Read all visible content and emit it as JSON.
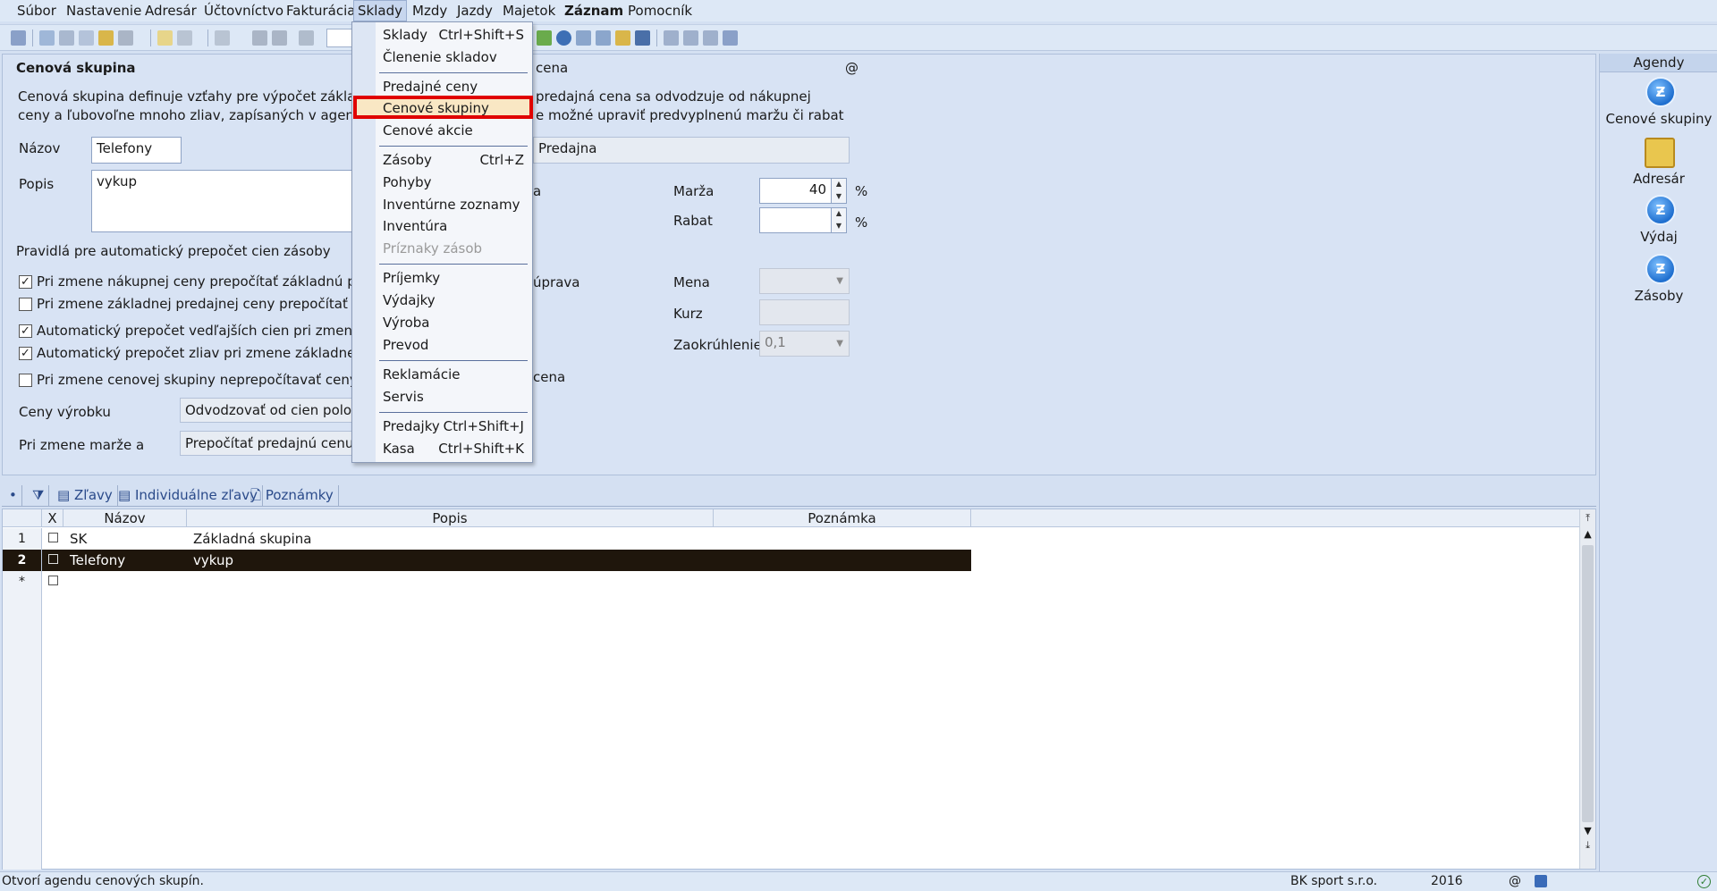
{
  "menubar": {
    "items": [
      "Súbor",
      "Nastavenie",
      "Adresár",
      "Účtovníctvo",
      "Fakturácia",
      "Sklady",
      "Mzdy",
      "Jazdy",
      "Majetok",
      "Záznam",
      "Pomocník"
    ],
    "active": "Sklady"
  },
  "form": {
    "section_title": "Cenová skupina",
    "description_line1": "Cenová skupina definuje vzťahy pre výpočet základnej p",
    "description_line2": "ceny a ľubovoľne mnoho zliav, zapísaných v agende Pre",
    "description_right1": "predajná cena sa odvodzuje od nákupnej",
    "description_right2": "e možné upraviť predvyplnenú maržu či rabat",
    "right_header": "cena",
    "at_sign": "@",
    "nazov_label": "Názov",
    "nazov_value": "Telefony",
    "popis_label": "Popis",
    "popis_value": "vykup",
    "predajna_value": "Predajna",
    "rules_title": "Pravidlá pre automatický prepočet cien zásoby",
    "checks": [
      {
        "label": "Pri zmene nákupnej ceny prepočítať základnú predajn",
        "checked": true
      },
      {
        "label": "Pri zmene základnej predajnej ceny prepočítať nákup",
        "checked": false
      },
      {
        "label": "Automatický prepočet vedľajších cien pri zmene náku",
        "checked": true
      },
      {
        "label": "Automatický prepočet zliav pri zmene základnej pred",
        "checked": true
      },
      {
        "label": "Pri zmene cenovej skupiny neprepočítavať ceny",
        "checked": false
      }
    ],
    "ceny_vyrobku_label": "Ceny výrobku",
    "ceny_vyrobku_value": "Odvodzovať od cien polože",
    "pri_zmene_marze_label": "Pri zmene marže a",
    "pri_zmene_marze_value": "Prepočítať predajnú cenu",
    "partial_a": "a",
    "partial_uprava": "úprava",
    "partial_cena": "cena",
    "marza_label": "Marža",
    "marza_value": "40",
    "rabat_label": "Rabat",
    "rabat_value": "",
    "percent": "%",
    "mena_label": "Mena",
    "kurz_label": "Kurz",
    "zaokruhlenie_label": "Zaokrúhlenie",
    "zaokruhlenie_value": "0,1"
  },
  "dropdown": {
    "items": [
      {
        "label": "Sklady",
        "shortcut": "Ctrl+Shift+S"
      },
      {
        "label": "Členenie skladov",
        "shortcut": ""
      },
      {
        "label": "Predajné ceny",
        "shortcut": ""
      },
      {
        "label": "Cenové skupiny",
        "shortcut": ""
      },
      {
        "label": "Cenové akcie",
        "shortcut": ""
      },
      {
        "label": "Zásoby",
        "shortcut": "Ctrl+Z"
      },
      {
        "label": "Pohyby",
        "shortcut": ""
      },
      {
        "label": "Inventúrne zoznamy",
        "shortcut": ""
      },
      {
        "label": "Inventúra",
        "shortcut": ""
      },
      {
        "label": "Príznaky zásob",
        "shortcut": ""
      },
      {
        "label": "Príjemky",
        "shortcut": ""
      },
      {
        "label": "Výdajky",
        "shortcut": ""
      },
      {
        "label": "Výroba",
        "shortcut": ""
      },
      {
        "label": "Prevod",
        "shortcut": ""
      },
      {
        "label": "Reklamácie",
        "shortcut": ""
      },
      {
        "label": "Servis",
        "shortcut": ""
      },
      {
        "label": "Predajky",
        "shortcut": "Ctrl+Shift+J"
      },
      {
        "label": "Kasa",
        "shortcut": "Ctrl+Shift+K"
      }
    ],
    "highlighted": "Cenové skupiny",
    "disabled": "Príznaky zásob"
  },
  "agendy": {
    "title": "Agendy",
    "items": [
      "Cenové skupiny",
      "Adresár",
      "Výdaj",
      "Zásoby"
    ]
  },
  "tabs": [
    "Zľavy",
    "Individuálne zľavy",
    "Poznámky"
  ],
  "grid": {
    "columns": [
      "X",
      "Názov",
      "Popis",
      "Poznámka"
    ],
    "rows": [
      {
        "num": "1",
        "nazov": "SK",
        "popis": "Základná skupina",
        "poznamka": ""
      },
      {
        "num": "2",
        "nazov": "Telefony",
        "popis": "vykup",
        "poznamka": ""
      }
    ],
    "new_row_marker": "*"
  },
  "statusbar": {
    "message": "Otvorí  agendu cenových skupín.",
    "company": "BK sport  s.r.o.",
    "year": "2016",
    "at": "@"
  }
}
